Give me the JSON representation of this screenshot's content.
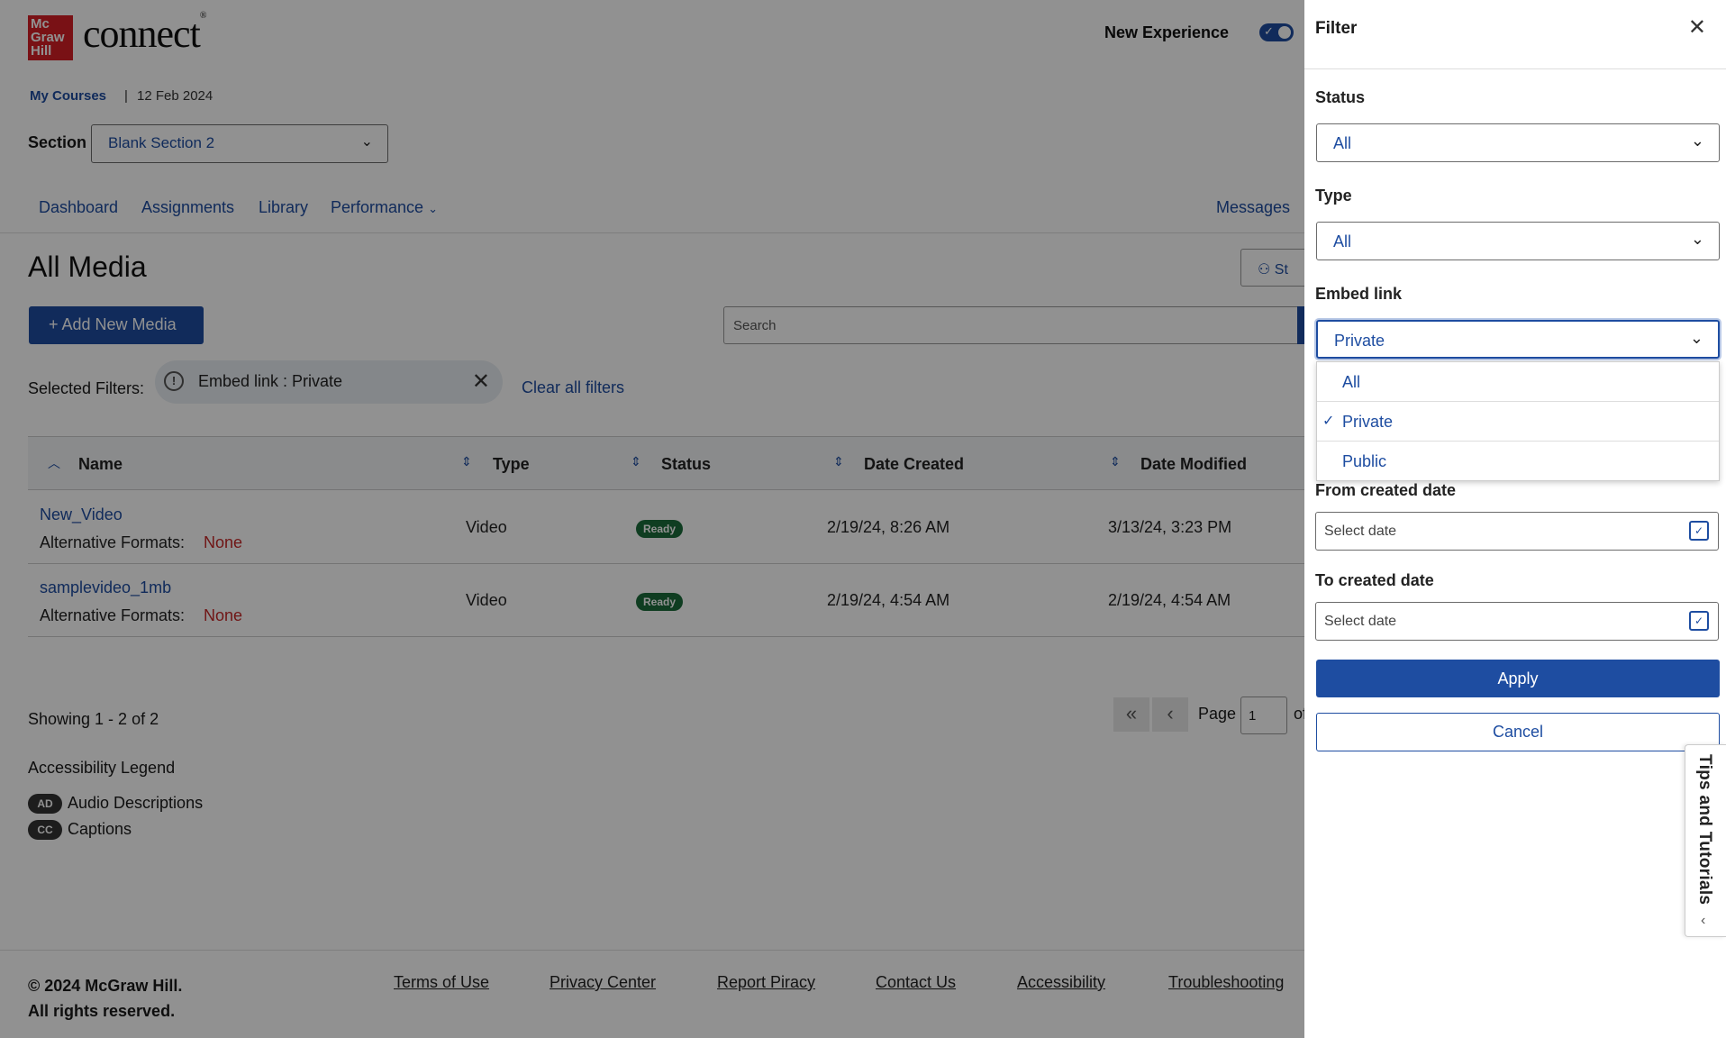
{
  "header": {
    "logo_text": "Mc Graw Hill",
    "brand": "connect",
    "new_experience_label": "New Experience"
  },
  "breadcrumb": {
    "my_courses": "My Courses",
    "date": "12 Feb 2024"
  },
  "section": {
    "label": "Section",
    "value": "Blank Section 2"
  },
  "nav": {
    "dashboard": "Dashboard",
    "assignments": "Assignments",
    "library": "Library",
    "performance": "Performance",
    "messages": "Messages"
  },
  "main": {
    "title": "All Media",
    "side_button": "St",
    "add_button": "+ Add New Media",
    "search_placeholder": "Search",
    "selected_filters_label": "Selected Filters:",
    "chip_text": "Embed link : Private",
    "clear_all": "Clear all filters"
  },
  "table": {
    "headers": {
      "name": "Name",
      "type": "Type",
      "status": "Status",
      "date_created": "Date Created",
      "date_modified": "Date Modified"
    },
    "alt_label": "Alternative Formats:",
    "rows": [
      {
        "name": "New_Video",
        "alt": "None",
        "type": "Video",
        "status": "Ready",
        "created": "2/19/24, 8:26 AM",
        "modified": "3/13/24, 3:23 PM"
      },
      {
        "name": "samplevideo_1mb",
        "alt": "None",
        "type": "Video",
        "status": "Ready",
        "created": "2/19/24, 4:54 AM",
        "modified": "2/19/24, 4:54 AM"
      }
    ]
  },
  "pagination": {
    "showing": "Showing 1 - 2 of 2",
    "page_label": "Page",
    "page_value": "1",
    "of": "of"
  },
  "legend": {
    "title": "Accessibility Legend",
    "items": [
      {
        "badge": "AD",
        "text": "Audio Descriptions"
      },
      {
        "badge": "CC",
        "text": "Captions"
      }
    ]
  },
  "footer": {
    "copyright": "© 2024 McGraw Hill.",
    "rights": "All rights reserved.",
    "links": {
      "terms": "Terms of Use",
      "privacy": "Privacy Center",
      "piracy": "Report Piracy",
      "contact": "Contact Us",
      "accessibility": "Accessibility",
      "troubleshooting": "Troubleshooting"
    }
  },
  "filter": {
    "title": "Filter",
    "status": {
      "label": "Status",
      "value": "All"
    },
    "type": {
      "label": "Type",
      "value": "All"
    },
    "embed": {
      "label": "Embed link",
      "value": "Private",
      "options": [
        "All",
        "Private",
        "Public"
      ]
    },
    "from_date": {
      "label": "From created date",
      "placeholder": "Select date"
    },
    "to_date": {
      "label": "To created date",
      "placeholder": "Select date"
    },
    "apply": "Apply",
    "cancel": "Cancel"
  },
  "tips": "Tips and Tutorials",
  "colors": {
    "brand_blue": "#1e4da1",
    "brand_red": "#d51f26",
    "ready_green": "#1c6b3a",
    "none_red": "#c62828"
  }
}
